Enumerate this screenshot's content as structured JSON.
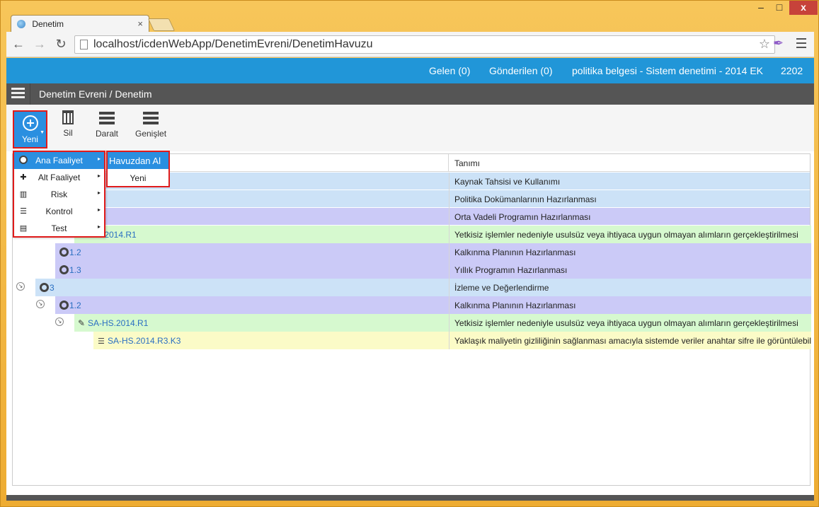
{
  "browser": {
    "tab_title": "Denetim",
    "tab_close": "×",
    "url": "localhost/icdenWebApp/DenetimEvreni/DenetimHavuzu",
    "star": "☆",
    "min": "–",
    "max": "□",
    "close": "x"
  },
  "topbar": {
    "inbox": "Gelen (0)",
    "sent": "Gönderilen (0)",
    "context": "politika belgesi - Sistem denetimi - 2014 EK",
    "year": "2202"
  },
  "subbar": {
    "breadcrumb": "Denetim Evreni / Denetim"
  },
  "actions": {
    "new": "Yeni",
    "delete": "Sil",
    "collapse": "Daralt",
    "expand": "Genişlet"
  },
  "grid": {
    "col2_header": "Tanımı",
    "rows": [
      {
        "code": "",
        "desc": "Kaynak Tahsisi ve Kullanımı",
        "tone": "blue"
      },
      {
        "code": "",
        "desc": "Politika Dokümanlarının Hazırlanması",
        "tone": "blue"
      },
      {
        "code": "",
        "desc": "Orta Vadeli Programın Hazırlanması",
        "tone": "purple"
      },
      {
        "code": "S.2014.R1",
        "desc": "Yetkisiz işlemler nedeniyle usulsüz veya ihtiyaca uygun olmayan alımların gerçekleştirilmesi",
        "tone": "green"
      },
      {
        "code": "1.2",
        "desc": "Kalkınma Planının Hazırlanması",
        "tone": "purple"
      },
      {
        "code": "1.3",
        "desc": "Yıllık Programın Hazırlanması",
        "tone": "purple"
      },
      {
        "code": "3",
        "desc": "İzleme ve Değerlendirme",
        "tone": "blue"
      },
      {
        "code": "1.2",
        "desc": "Kalkınma Planının Hazırlanması",
        "tone": "purple"
      },
      {
        "code": "SA-HS.2014.R1",
        "desc": "Yetkisiz işlemler nedeniyle usulsüz veya ihtiyaca uygun olmayan alımların gerçekleştirilmesi",
        "tone": "green"
      },
      {
        "code": "SA-HS.2014.R3.K3",
        "desc": "Yaklaşık maliyetin gizliliğinin sağlanması amacıyla sistemde veriler anahtar sifre ile görüntülebilir",
        "tone": "yellow"
      }
    ]
  },
  "new_menu": {
    "items": [
      "Ana Faaliyet",
      "Alt Faaliyet",
      "Risk",
      "Kontrol",
      "Test"
    ],
    "arrow": "▸"
  },
  "submenu": {
    "from_pool": "Havuzdan Al",
    "new": "Yeni"
  }
}
